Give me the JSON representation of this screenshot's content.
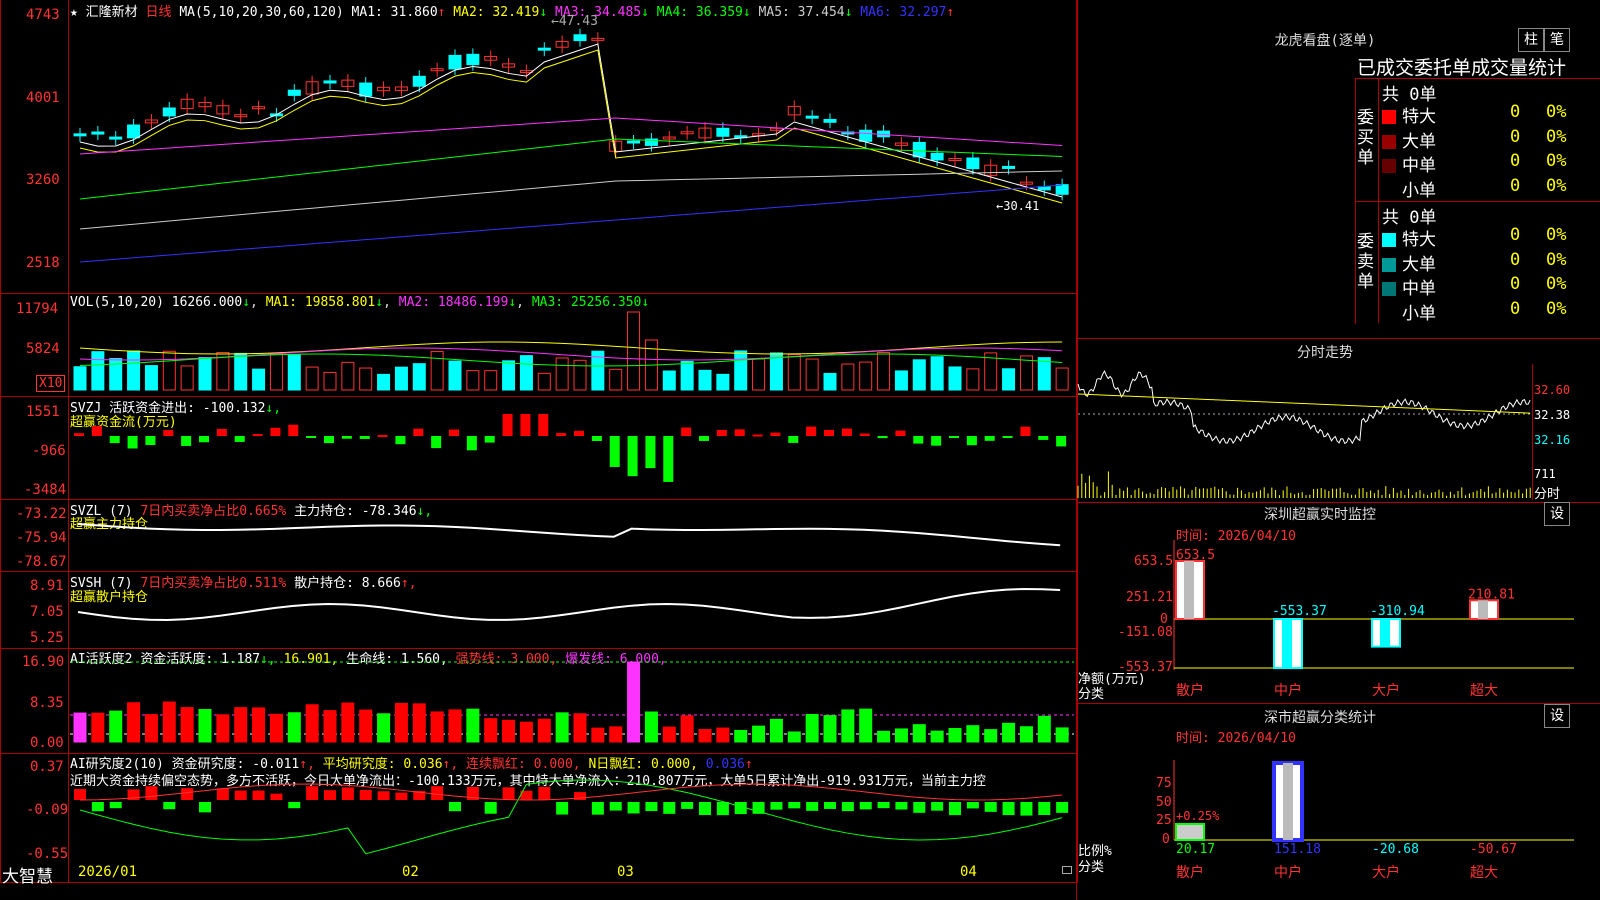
{
  "stock": {
    "name": "汇隆新材",
    "period": "日线",
    "star": "★",
    "ma_params": "MA(5,10,20,30,60,120)",
    "ma": [
      {
        "label": "MA1:",
        "value": "31.860",
        "arrow": "↑",
        "color": "#ffffff"
      },
      {
        "label": "MA2:",
        "value": "32.419",
        "arrow": "↓",
        "color": "#ffff00"
      },
      {
        "label": "MA3:",
        "value": "34.485",
        "arrow": "↓",
        "color": "#ff33ff"
      },
      {
        "label": "MA4:",
        "value": "36.359",
        "arrow": "↓",
        "color": "#00ff00"
      },
      {
        "label": "MA5:",
        "value": "37.454",
        "arrow": "↓",
        "color": "#cccccc"
      },
      {
        "label": "MA6:",
        "value": "32.297",
        "arrow": "↑",
        "color": "#3333ff"
      }
    ],
    "price_axis": [
      "4743",
      "4001",
      "3260",
      "2518"
    ],
    "high_mark": "47.43",
    "low_mark": "30.41"
  },
  "vol": {
    "title": "VOL(5,10,20)",
    "value": "16266.000",
    "arrow": "↓",
    "ma1": "MA1: 19858.801",
    "ma1_arrow": "↓",
    "ma2": "MA2: 18486.199",
    "ma2_arrow": "↓",
    "ma3": "MA3: 25256.350",
    "ma3_arrow": "↓",
    "axis": [
      "11794",
      "5824"
    ],
    "unit": "X10"
  },
  "svzj": {
    "title": "SVZJ",
    "line": "活跃资金进出: -100.132",
    "arrow": "↓,",
    "sub": "超赢资金流(万元)",
    "axis": [
      "1551",
      "-966",
      "-3484"
    ]
  },
  "svzl": {
    "title": "SVZL (7)",
    "ratio": "7日内买卖净占比0.665%",
    "main": "主力持仓: -78.346",
    "arrow": "↓,",
    "sub": "超赢主力持仓",
    "axis": [
      "-73.22",
      "-75.94",
      "-78.67"
    ]
  },
  "svsh": {
    "title": "SVSH (7)",
    "ratio": "7日内买卖净占比0.511%",
    "main": "散户持仓: 8.666",
    "arrow": "↑,",
    "sub": "超赢散户持仓",
    "axis": [
      "8.91",
      "7.05",
      "5.25"
    ]
  },
  "ai_active": {
    "title": "AI活跃度2",
    "label": "资金活跃度: 1.187",
    "arrow": "↓,",
    "v2": "16.901,",
    "life": "生命线: 1.560,",
    "strong": "强势线: 3.000,",
    "burst": "爆发线: 6.000,",
    "axis": [
      "16.90",
      "8.35",
      "0.00"
    ]
  },
  "ai_research": {
    "title": "AI研究度2(10)",
    "label": "资金研究度: -0.011",
    "arrow": "↑,",
    "avg": "平均研究度: 0.036",
    "avg_arrow": "↑,",
    "streak": "连续飘红: 0.000,",
    "nday": "N日飘红: 0.000,",
    "last": "0.036",
    "last_arrow": "↑",
    "comment": "近期大资金持续偏空态势，多方不活跃，今日大单净流出：-100.133万元，其中特大单净流入：210.807万元，大单5日累计净出-919.931万元，当前主力控",
    "axis": [
      "0.37",
      "-0.09",
      "-0.55"
    ]
  },
  "date_axis": [
    "2026/01",
    "02",
    "03",
    "04"
  ],
  "brand": "大智慧",
  "dragon": {
    "title": "龙虎看盘(逐单)",
    "btn1": "柱",
    "btn2": "笔",
    "header": "已成交委托单成交量统计",
    "buy_label": "委买单",
    "sell_label": "委卖单",
    "buy_total": "共 0单",
    "sell_total": "共 0单",
    "buy_rows": [
      {
        "name": "特大",
        "count": "0",
        "pct": "0%",
        "color": "#ff0000"
      },
      {
        "name": "大单",
        "count": "0",
        "pct": "0%",
        "color": "#990000"
      },
      {
        "name": "中单",
        "count": "0",
        "pct": "0%",
        "color": "#660000"
      },
      {
        "name": "小单",
        "count": "0",
        "pct": "0%",
        "color": "#000000"
      }
    ],
    "sell_rows": [
      {
        "name": "特大",
        "count": "0",
        "pct": "0%",
        "color": "#00ffff"
      },
      {
        "name": "大单",
        "count": "0",
        "pct": "0%",
        "color": "#009999"
      },
      {
        "name": "中单",
        "count": "0",
        "pct": "0%",
        "color": "#007777"
      },
      {
        "name": "小单",
        "count": "0",
        "pct": "0%",
        "color": "#000000"
      }
    ]
  },
  "intraday": {
    "title": "分时走势",
    "axis": [
      "32.60",
      "32.38",
      "32.16"
    ],
    "vol_axis": "711",
    "vol_label": "分时"
  },
  "sz_monitor": {
    "title": "深圳超赢实时监控",
    "set": "设",
    "time": "时间: 2026/04/10",
    "axis": [
      "653.5",
      "251.21",
      "0",
      "-151.08",
      "-553.37"
    ],
    "ylabel": "净额(万元)",
    "xlabel": "分类",
    "categories": [
      "散户",
      "中户",
      "大户",
      "超大"
    ],
    "values": [
      "653.5",
      "-553.37",
      "-310.94",
      "210.81"
    ]
  },
  "sz_stats": {
    "title": "深市超赢分类统计",
    "set": "设",
    "time": "时间: 2026/04/10",
    "axis": [
      "75",
      "50",
      "25",
      "0"
    ],
    "ylabel": "比例%",
    "xlabel": "分类",
    "categories": [
      "散户",
      "中户",
      "大户",
      "超大"
    ],
    "values": [
      "20.17",
      "151.18",
      "-20.68",
      "-50.67"
    ],
    "top_label": "+0.25%"
  },
  "chart_data": [
    {
      "type": "bar",
      "title": "深圳超赢实时监控",
      "xlabel": "分类",
      "ylabel": "净额(万元)",
      "categories": [
        "散户",
        "中户",
        "大户",
        "超大"
      ],
      "values": [
        653.5,
        -553.37,
        -310.94,
        210.81
      ],
      "ylim": [
        -553.37,
        653.5
      ]
    },
    {
      "type": "bar",
      "title": "深市超赢分类统计",
      "xlabel": "分类",
      "ylabel": "比例%",
      "categories": [
        "散户",
        "中户",
        "大户",
        "超大"
      ],
      "values": [
        20.17,
        151.18,
        -20.68,
        -50.67
      ],
      "ylim": [
        0,
        75
      ]
    }
  ]
}
